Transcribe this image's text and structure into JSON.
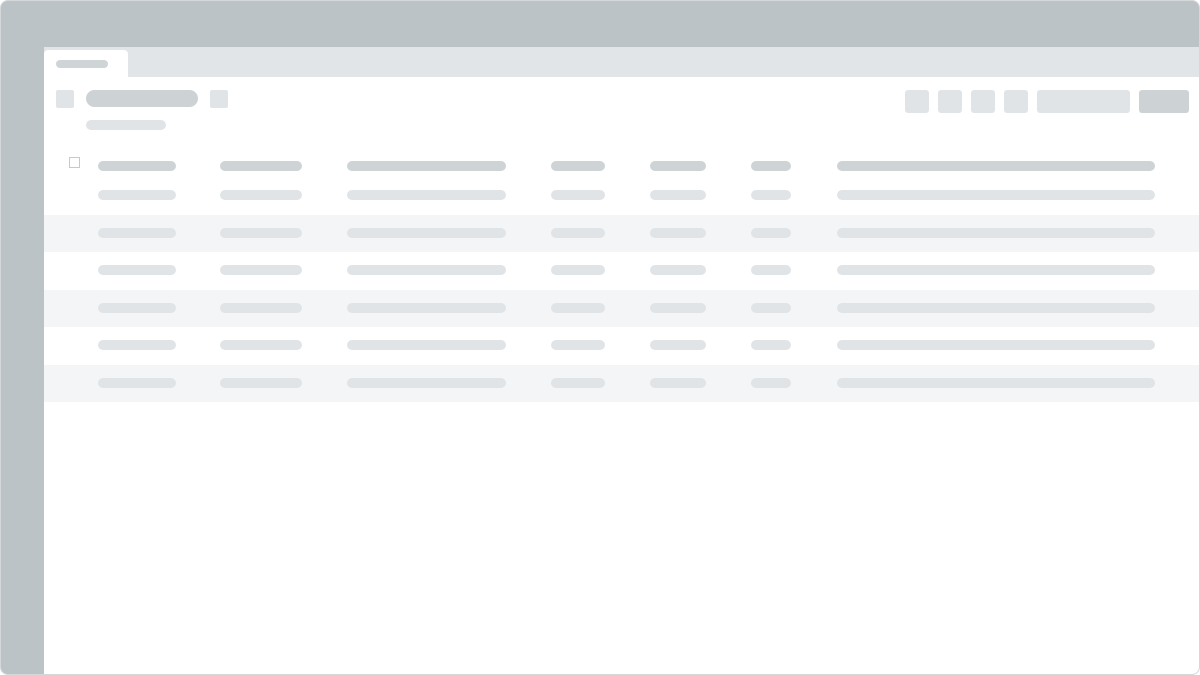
{
  "window": {
    "tabs": [
      {
        "label": ""
      }
    ],
    "page_title": "",
    "page_subtitle": ""
  },
  "toolbar": {
    "icon_buttons": [
      "",
      "",
      "",
      ""
    ],
    "secondary_button_label": "",
    "primary_button_label": ""
  },
  "table": {
    "columns": [
      "",
      "",
      "",
      "",
      "",
      "",
      ""
    ],
    "rows": [
      {
        "cells": [
          "",
          "",
          "",
          "",
          "",
          "",
          ""
        ]
      },
      {
        "cells": [
          "",
          "",
          "",
          "",
          "",
          "",
          ""
        ]
      },
      {
        "cells": [
          "",
          "",
          "",
          "",
          "",
          "",
          ""
        ]
      },
      {
        "cells": [
          "",
          "",
          "",
          "",
          "",
          "",
          ""
        ]
      },
      {
        "cells": [
          "",
          "",
          "",
          "",
          "",
          "",
          ""
        ]
      },
      {
        "cells": [
          "",
          "",
          "",
          "",
          "",
          "",
          ""
        ]
      }
    ]
  },
  "colors": {
    "frame": "#bcc3c7",
    "tabstrip": "#e2e5e7",
    "placeholder_dark": "#cdd2d5",
    "placeholder_light": "#e1e4e6",
    "row_alt": "#f4f5f6"
  }
}
